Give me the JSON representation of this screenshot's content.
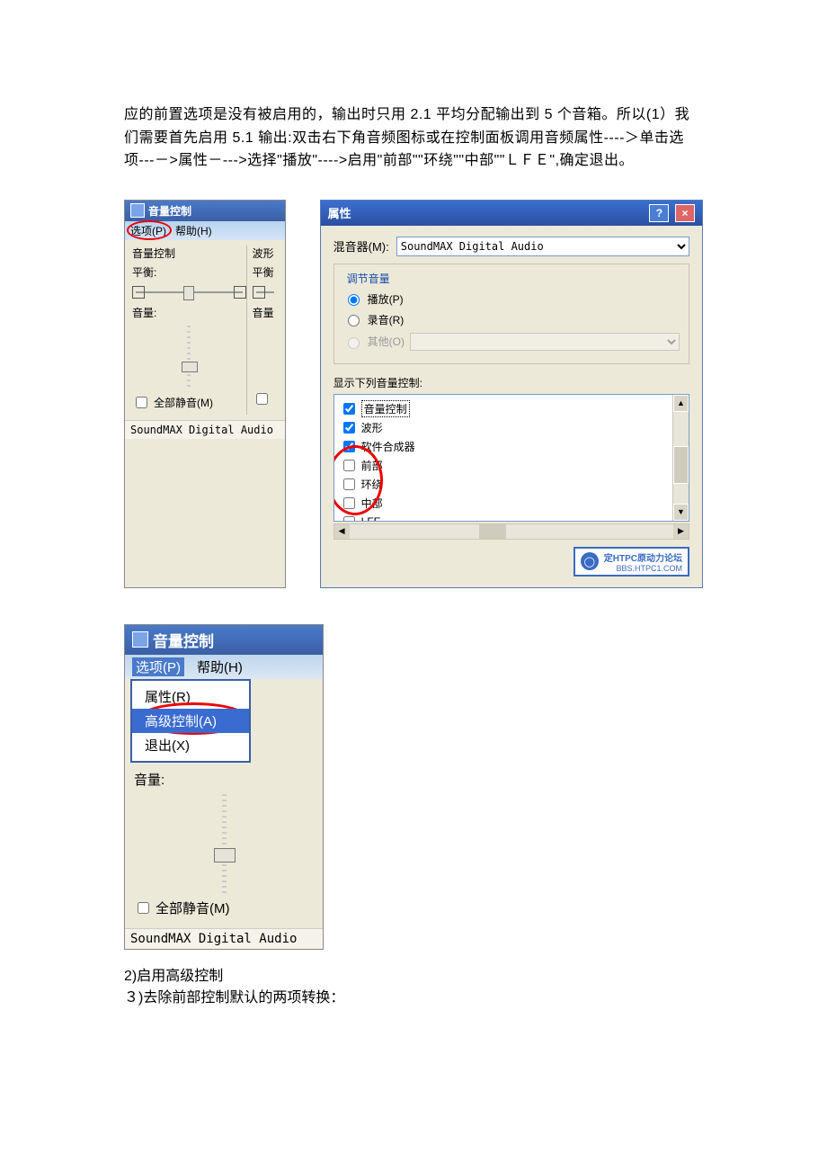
{
  "para": "应的前置选项是没有被启用的，输出时只用 2.1 平均分配输出到 5 个音箱。所以(1）我们需要首先启用 5.1 输出:双击右下角音频图标或在控制面板调用音频属性----＞单击选项---－>属性－--->选择\"播放\"---->启用\"前部\"\"环绕\"\"中部\"\"ＬＦＥ\",确定退出。",
  "vc1": {
    "title": "音量控制",
    "menu_options": "选项(P)",
    "menu_help": "帮助(H)",
    "col1_title": "音量控制",
    "balance": "平衡:",
    "volume": "音量:",
    "mute_all": "全部静音(M)",
    "col2_title": "波形",
    "col2_balance": "平衡",
    "col2_volume": "音量",
    "device": "SoundMAX Digital Audio"
  },
  "prop": {
    "title": "属性",
    "mixer_label": "混音器(M):",
    "mixer_value": "SoundMAX Digital Audio",
    "adjust_title": "调节音量",
    "r_play": "播放(P)",
    "r_rec": "录音(R)",
    "r_other": "其他(O)",
    "list_label": "显示下列音量控制:",
    "items": [
      "音量控制",
      "波形",
      "软件合成器",
      "前部",
      "环绕",
      "中部",
      "LFE"
    ],
    "checked": [
      true,
      true,
      true,
      false,
      false,
      false,
      false
    ],
    "watermark_l1": "定HTPC原动力论坛",
    "watermark_l2": "BBS.HTPC1.COM"
  },
  "vc2": {
    "title": "音量控制",
    "menu_options": "选项(P)",
    "menu_help": "帮助(H)",
    "dd_props": "属性(R)",
    "dd_adv": "高级控制(A)",
    "dd_exit": "退出(X)",
    "volume": "音量:",
    "mute_all": "全部静音(M)",
    "device": "SoundMAX Digital Audio"
  },
  "end": {
    "l1": "2)启用高级控制",
    "l2": "３)去除前部控制默认的两项转换："
  }
}
